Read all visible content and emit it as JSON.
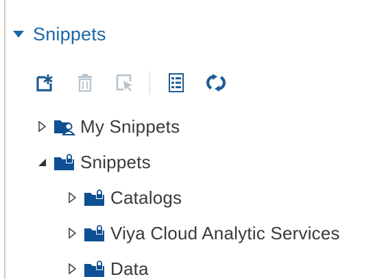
{
  "section": {
    "title": "Snippets",
    "expanded": true
  },
  "toolbar": {
    "buttons": [
      {
        "icon": "new-snippet-icon",
        "enabled": true
      },
      {
        "icon": "trash-icon",
        "enabled": false
      },
      {
        "icon": "edit-icon",
        "enabled": false
      },
      {
        "icon": "list-icon",
        "enabled": true
      },
      {
        "icon": "refresh-icon",
        "enabled": true
      }
    ]
  },
  "tree": {
    "items": [
      {
        "label": "My Snippets",
        "icon": "user-folder-icon",
        "expanded": false,
        "level": 1
      },
      {
        "label": "Snippets",
        "icon": "locked-folder-icon",
        "expanded": true,
        "level": 1
      },
      {
        "label": "Catalogs",
        "icon": "locked-folder-icon",
        "expanded": false,
        "level": 2
      },
      {
        "label": "Viya Cloud Analytic Services",
        "icon": "locked-folder-icon",
        "expanded": false,
        "level": 2
      },
      {
        "label": "Data",
        "icon": "locked-folder-icon",
        "expanded": false,
        "level": 2
      }
    ]
  },
  "colors": {
    "accent": "#1a67a8",
    "icon_active": "#1c5c97",
    "icon_disabled": "#b9c4cf",
    "text": "#3a3a3a",
    "folder_dark": "#0f4f93"
  }
}
